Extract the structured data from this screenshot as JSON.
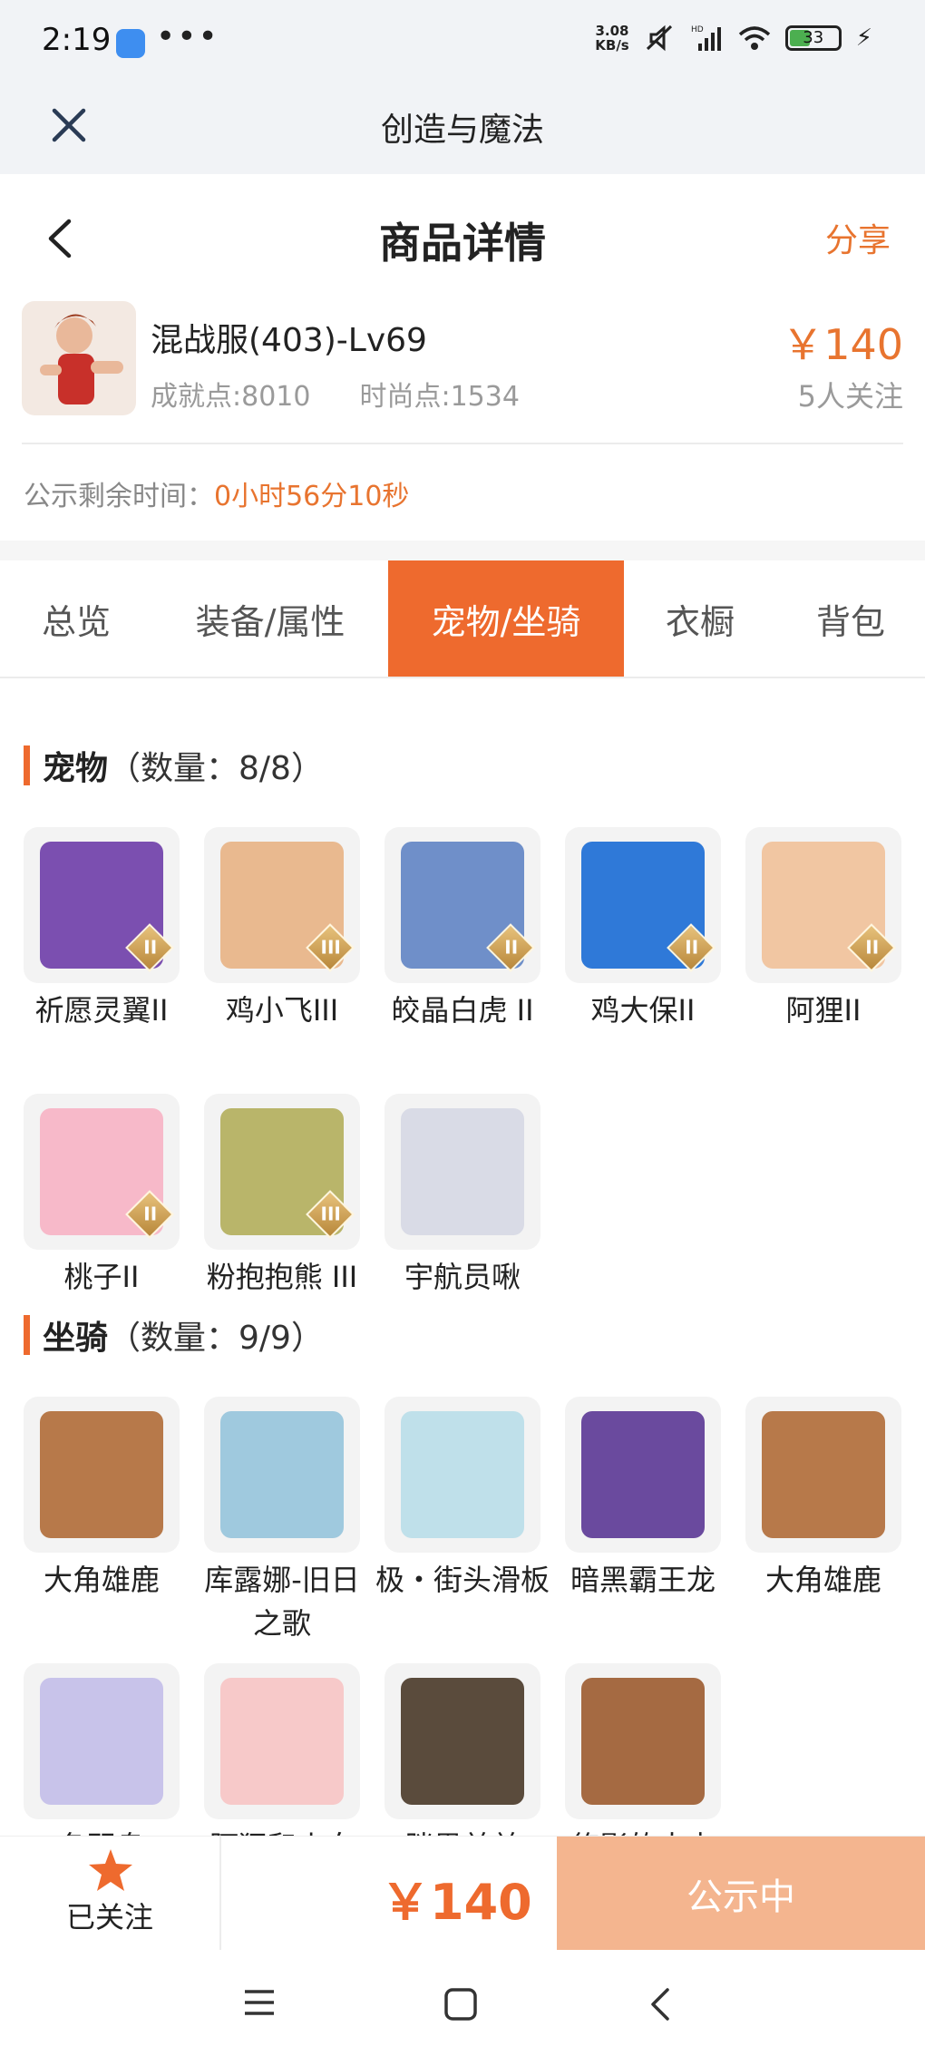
{
  "status_bar": {
    "time": "2:19",
    "more": "•••",
    "net_speed_value": "3.08",
    "net_speed_unit": "KB/s",
    "signal_label": "HD",
    "battery": "33"
  },
  "app_bar": {
    "title": "创造与魔法"
  },
  "page_header": {
    "title": "商品详情",
    "share_label": "分享"
  },
  "product": {
    "name": "混战服(403)-Lv69",
    "achievement": "成就点:8010",
    "fashion": "时尚点:1534",
    "price": "￥140",
    "watchers": "5人关注"
  },
  "countdown": {
    "label": "公示剩余时间：",
    "value": "0小时56分10秒"
  },
  "tabs": [
    {
      "label": "总览"
    },
    {
      "label": "装备/属性"
    },
    {
      "label": "宠物/坐骑",
      "active": true
    },
    {
      "label": "衣橱"
    },
    {
      "label": "背包"
    }
  ],
  "pets": {
    "title": "宠物",
    "count": "（数量：8/8）",
    "items": [
      {
        "label": "祈愿灵翼II",
        "rank": "II",
        "color": "#7b4fb0"
      },
      {
        "label": "鸡小飞III",
        "rank": "III",
        "color": "#e9b98f"
      },
      {
        "label": "皎晶白虎 II",
        "rank": "II",
        "color": "#6f8fc9"
      },
      {
        "label": "鸡大保II",
        "rank": "II",
        "color": "#2f79d8"
      },
      {
        "label": "阿狸II",
        "rank": "II",
        "color": "#f1c6a2"
      },
      {
        "label": "桃子II",
        "rank": "II",
        "color": "#f7b9c9"
      },
      {
        "label": "粉抱抱熊 III",
        "rank": "III",
        "color": "#b9b56a"
      },
      {
        "label": "宇航员啾",
        "rank": "",
        "color": "#d9dbe6"
      }
    ]
  },
  "mounts": {
    "title": "坐骑",
    "count": "（数量：9/9）",
    "items": [
      {
        "label": "大角雄鹿",
        "color": "#b7794a"
      },
      {
        "label": "库露娜-旧日之歌",
        "color": "#9fc9de"
      },
      {
        "label": "极・街头滑板",
        "color": "#bfe0ea"
      },
      {
        "label": "暗黑霸王龙",
        "color": "#6a4a9e"
      },
      {
        "label": "大角雄鹿",
        "color": "#b7794a"
      },
      {
        "label": "冬羽鸟",
        "color": "#c8c3ea"
      },
      {
        "label": "阿狸和小白",
        "color": "#f7c9c9"
      },
      {
        "label": "胖黑羊羊",
        "color": "#5a4b3c"
      },
      {
        "label": "悠影的大卡",
        "color": "#a56a42"
      }
    ]
  },
  "action_bar": {
    "follow_label": "已关注",
    "price": "￥140",
    "status_label": "公示中"
  }
}
